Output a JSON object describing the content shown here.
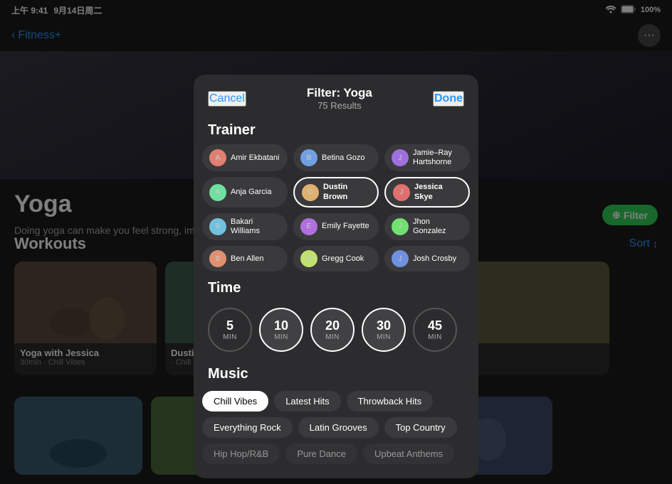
{
  "statusBar": {
    "time": "上午 9:41",
    "date": "9月14日周二",
    "wifi": "100%",
    "battery": "100%"
  },
  "nav": {
    "backLabel": "Fitness+",
    "moreIcon": "···"
  },
  "yogaSection": {
    "title": "Yoga",
    "description": "Doing yoga can make you feel strong, improve balance, and encourage min...",
    "filterLabel": "Filter"
  },
  "workouts": {
    "title": "Workouts",
    "sortLabel": "Sort"
  },
  "cards": [
    {
      "title": "Yoga with Jessica",
      "sub": "30min · Chill Vibes"
    },
    {
      "title": "Dustin",
      "sub": "· Chill Vibes"
    }
  ],
  "modal": {
    "cancelLabel": "Cancel",
    "titleLabel": "Filter: Yoga",
    "resultsLabel": "75 Results",
    "doneLabel": "Done",
    "trainerSection": "Trainer",
    "timeSection": "Time",
    "musicSection": "Music"
  },
  "trainers": [
    {
      "name": "Amir Ekbatani",
      "selected": false
    },
    {
      "name": "Betina Gozo",
      "selected": false
    },
    {
      "name": "Jamie–Ray Hartshorne",
      "selected": false
    },
    {
      "name": "Anja Garcia",
      "selected": false
    },
    {
      "name": "Dustin Brown",
      "selected": true
    },
    {
      "name": "Jessica Skye",
      "selected": true
    },
    {
      "name": "Bakari Williams",
      "selected": false
    },
    {
      "name": "Emily Fayette",
      "selected": false
    },
    {
      "name": "Jhon Gonzalez",
      "selected": false
    },
    {
      "name": "Ben Allen",
      "selected": false
    },
    {
      "name": "Gregg Cook",
      "selected": false
    },
    {
      "name": "Josh Crosby",
      "selected": false
    }
  ],
  "times": [
    {
      "value": "5",
      "label": "MIN",
      "selected": false
    },
    {
      "value": "10",
      "label": "MIN",
      "selected": true
    },
    {
      "value": "20",
      "label": "MIN",
      "selected": true
    },
    {
      "value": "30",
      "label": "MIN",
      "selected": true
    },
    {
      "value": "45",
      "label": "MIN",
      "selected": false
    }
  ],
  "musicOptions": [
    {
      "label": "Chill Vibes",
      "selected": true
    },
    {
      "label": "Latest Hits",
      "selected": false
    },
    {
      "label": "Throwback Hits",
      "selected": false
    },
    {
      "label": "Everything Rock",
      "selected": false
    },
    {
      "label": "Latin Grooves",
      "selected": false
    },
    {
      "label": "Top Country",
      "selected": false
    }
  ],
  "musicPartial": [
    {
      "label": "Hip Hop/R&B"
    },
    {
      "label": "Pure Dance"
    },
    {
      "label": "Upbeat Anthems"
    }
  ],
  "filterButton": {
    "icon": "⊕",
    "label": "Filter"
  }
}
